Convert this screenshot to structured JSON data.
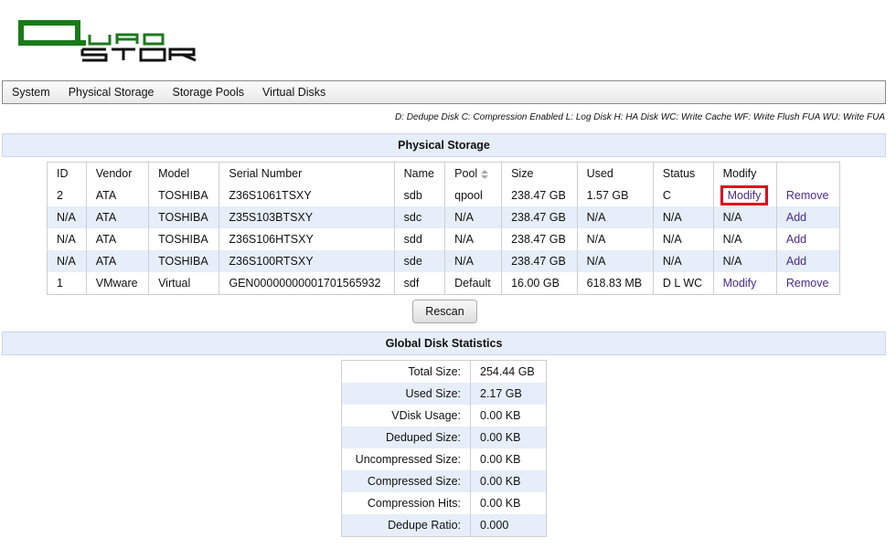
{
  "logo": {
    "text": "QUADSTOR",
    "color": "#1a7a1a"
  },
  "menu": [
    "System",
    "Physical Storage",
    "Storage Pools",
    "Virtual Disks"
  ],
  "legend": "D: Dedupe Disk C: Compression Enabled L: Log Disk H: HA Disk WC: Write Cache WF: Write Flush FUA WU: Write FUA",
  "physical_storage": {
    "title": "Physical Storage",
    "columns": [
      "ID",
      "Vendor",
      "Model",
      "Serial Number",
      "Name",
      "Pool",
      "Size",
      "Used",
      "Status",
      "Modify",
      ""
    ],
    "rows": [
      {
        "id": "2",
        "vendor": "ATA",
        "model": "TOSHIBA",
        "serial": "Z36S1061TSXY",
        "name": "sdb",
        "pool": "qpool",
        "size": "238.47 GB",
        "used": "1.57 GB",
        "status": "C",
        "modify": "Modify",
        "action": "Remove"
      },
      {
        "id": "N/A",
        "vendor": "ATA",
        "model": "TOSHIBA",
        "serial": "Z35S103BTSXY",
        "name": "sdc",
        "pool": "N/A",
        "size": "238.47 GB",
        "used": "N/A",
        "status": "N/A",
        "modify": "N/A",
        "action": "Add"
      },
      {
        "id": "N/A",
        "vendor": "ATA",
        "model": "TOSHIBA",
        "serial": "Z36S106HTSXY",
        "name": "sdd",
        "pool": "N/A",
        "size": "238.47 GB",
        "used": "N/A",
        "status": "N/A",
        "modify": "N/A",
        "action": "Add"
      },
      {
        "id": "N/A",
        "vendor": "ATA",
        "model": "TOSHIBA",
        "serial": "Z36S100RTSXY",
        "name": "sde",
        "pool": "N/A",
        "size": "238.47 GB",
        "used": "N/A",
        "status": "N/A",
        "modify": "N/A",
        "action": "Add"
      },
      {
        "id": "1",
        "vendor": "VMware",
        "model": "Virtual",
        "serial": "GEN00000000001701565932",
        "name": "sdf",
        "pool": "Default",
        "size": "16.00 GB",
        "used": "618.83 MB",
        "status": "D L WC",
        "modify": "Modify",
        "action": "Remove"
      }
    ],
    "rescan_label": "Rescan"
  },
  "global_stats": {
    "title": "Global Disk Statistics",
    "rows": [
      {
        "label": "Total Size:",
        "value": "254.44 GB"
      },
      {
        "label": "Used Size:",
        "value": "2.17 GB"
      },
      {
        "label": "VDisk Usage:",
        "value": "0.00 KB"
      },
      {
        "label": "Deduped Size:",
        "value": "0.00 KB"
      },
      {
        "label": "Uncompressed Size:",
        "value": "0.00 KB"
      },
      {
        "label": "Compressed Size:",
        "value": "0.00 KB"
      },
      {
        "label": "Compression Hits:",
        "value": "0.00 KB"
      },
      {
        "label": "Dedupe Ratio:",
        "value": "0.000"
      }
    ]
  },
  "colors": {
    "link": "#4b2a8a",
    "header_bg": "#e6eefa",
    "highlight": "#e0001b"
  }
}
